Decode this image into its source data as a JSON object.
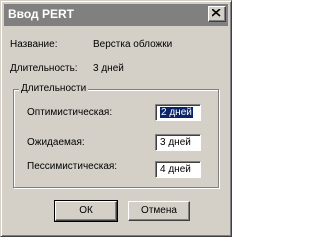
{
  "window": {
    "title": "Ввод PERT"
  },
  "info": {
    "name_label": "Название:",
    "name_value": "Верстка обложки",
    "duration_label": "Длительность:",
    "duration_value": "3 дней"
  },
  "group": {
    "legend": "Длительности",
    "optimistic": {
      "label": "Оптимистическая:",
      "value": "2 дней"
    },
    "expected": {
      "label": "Ожидаемая:",
      "value": "3 дней"
    },
    "pessimistic": {
      "label": "Пессимистическая:",
      "value": "4 дней"
    }
  },
  "buttons": {
    "ok": "ОК",
    "cancel": "Отмена"
  },
  "icons": {
    "close": "close-icon"
  },
  "colors": {
    "titlebar": "#808080",
    "dialog": "#d4d0c8",
    "selection": "#0a246a"
  }
}
